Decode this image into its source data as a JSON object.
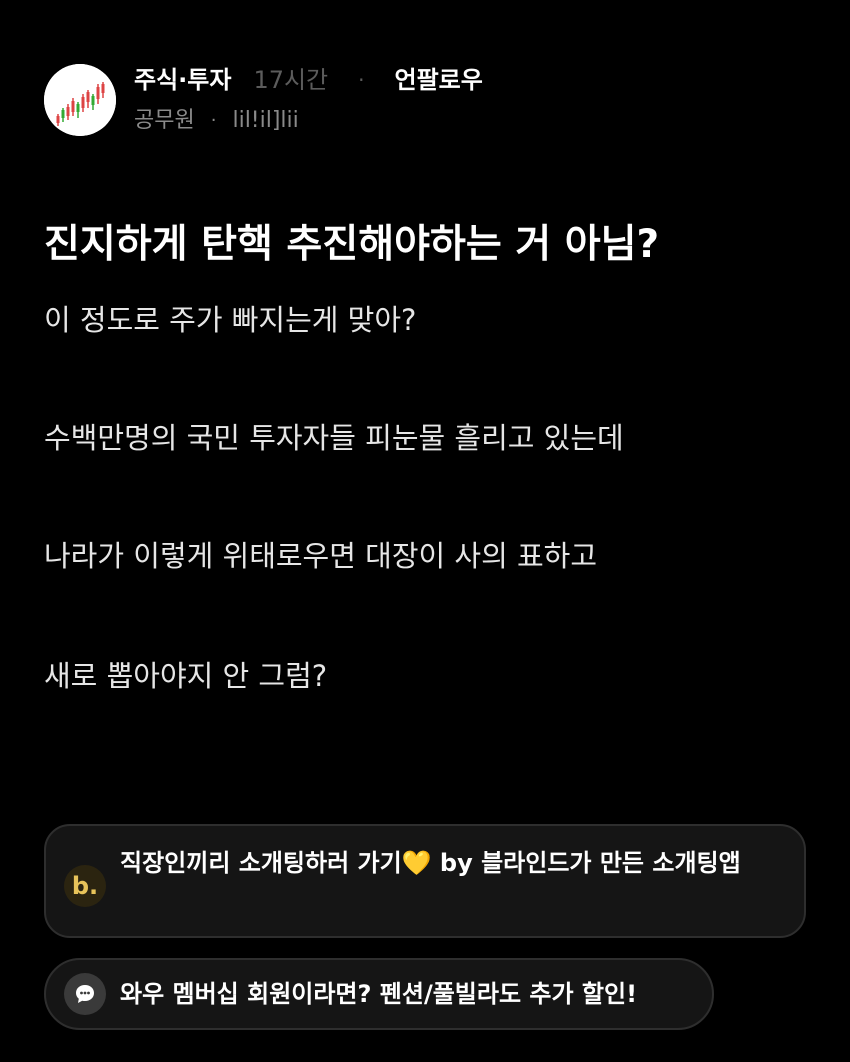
{
  "post": {
    "category": "주식·투자",
    "time": "17시간",
    "separator": "·",
    "unfollow_label": "언팔로우",
    "author_company": "공무원",
    "author_nick": "lil!il]lii"
  },
  "title": "진지하게 탄핵 추진해야하는 거 아님?",
  "body": {
    "line1": "이 정도로 주가 빠지는게 맞아?",
    "line2": "수백만명의 국민 투자자들 피눈물 흘리고 있는데",
    "line3": "나라가 이렇게 위태로우면 대장이 사의 표하고",
    "line4": "새로 뽑아야지 안 그럼?"
  },
  "ads": {
    "ad1": {
      "icon": "b.",
      "text_before": "직장인끼리 소개팅하러 가기",
      "heart": "💛",
      "text_after": " by 블라인드가 만든 소개팅앱"
    },
    "ad2": {
      "icon": "chat-bubble-icon",
      "text": "와우 멤버십 회원이라면? 펜션/풀빌라도 추가 할인!"
    }
  },
  "colors": {
    "background": "#000000",
    "card_background": "#151515",
    "muted": "#5c5c5c",
    "accent_yellow": "#f4c02c"
  }
}
